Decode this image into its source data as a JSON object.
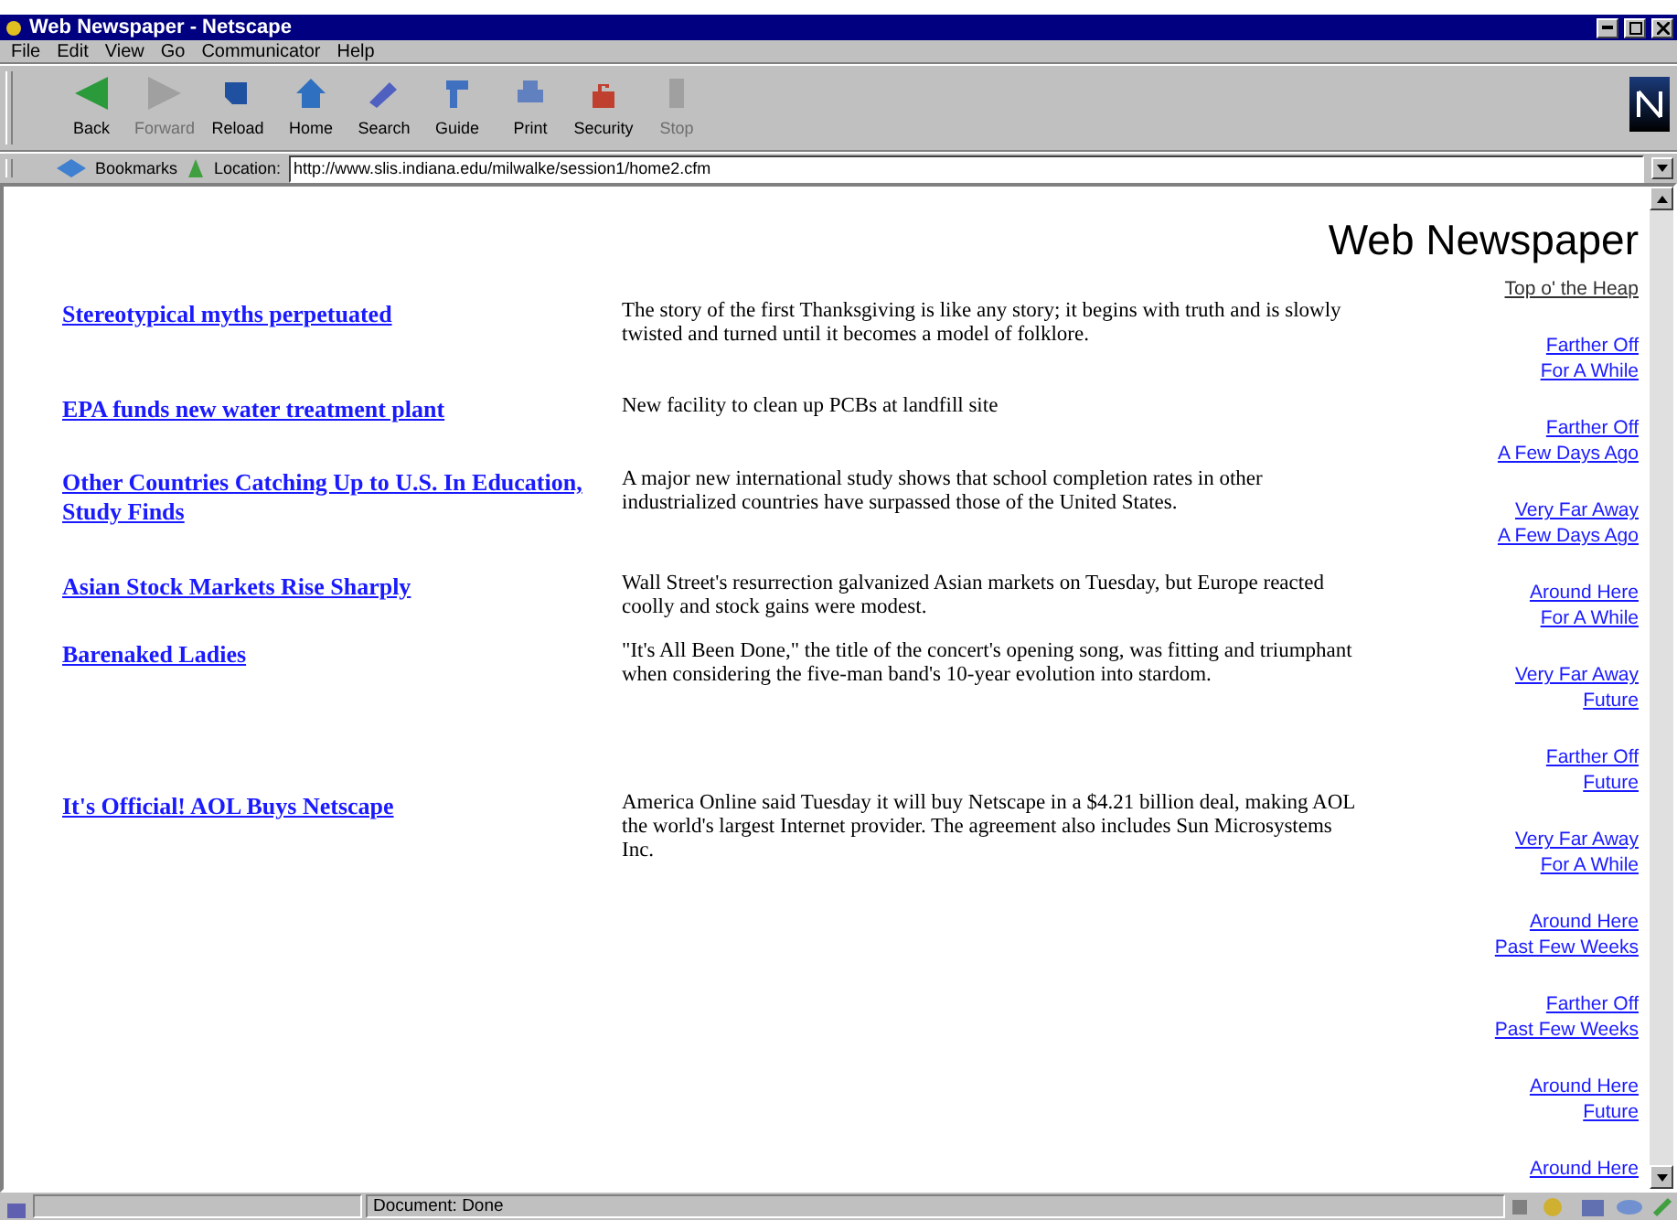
{
  "window": {
    "title": "Web Newspaper - Netscape"
  },
  "menu": [
    "File",
    "Edit",
    "View",
    "Go",
    "Communicator",
    "Help"
  ],
  "toolbar": [
    {
      "label": "Back",
      "kind": "back",
      "disabled": false
    },
    {
      "label": "Forward",
      "kind": "forward",
      "disabled": true
    },
    {
      "label": "Reload",
      "kind": "reload",
      "disabled": false
    },
    {
      "label": "Home",
      "kind": "home",
      "disabled": false
    },
    {
      "label": "Search",
      "kind": "search",
      "disabled": false
    },
    {
      "label": "Guide",
      "kind": "guide",
      "disabled": false
    },
    {
      "label": "Print",
      "kind": "print",
      "disabled": false
    },
    {
      "label": "Security",
      "kind": "security",
      "disabled": false
    },
    {
      "label": "Stop",
      "kind": "stop",
      "disabled": true
    }
  ],
  "location_bar": {
    "bookmarks": "Bookmarks",
    "label": "Location:",
    "url": "http://www.slis.indiana.edu/milwalke/session1/home2.cfm"
  },
  "page": {
    "heading": "Web Newspaper",
    "articles": [
      {
        "headline": "Stereotypical myths perpetuated",
        "summary": "The story of the first Thanksgiving is like any story; it begins with truth and is slowly twisted and turned until it becomes a model of folklore."
      },
      {
        "headline": "EPA funds new water treatment plant",
        "summary": "New facility to clean up PCBs at landfill site"
      },
      {
        "headline": "Other Countries Catching Up to U.S. In Education, Study Finds",
        "summary": "A major new international study shows that school completion rates in other industrialized countries have surpassed those of the United States."
      },
      {
        "headline": "Asian Stock Markets Rise Sharply",
        "summary": "Wall Street's resurrection galvanized Asian markets on Tuesday, but Europe reacted coolly and stock gains were modest."
      },
      {
        "headline": "Barenaked Ladies",
        "summary": "\"It's All Been Done,\" the title of the concert's opening song, was fitting and triumphant when considering the five-man band's 10-year evolution into stardom."
      },
      {
        "headline": "It's Official! AOL Buys Netscape",
        "summary": "America Online said Tuesday it will buy Netscape in a $4.21 billion deal, making AOL the world's largest Internet provider. The agreement also includes Sun Microsystems Inc."
      }
    ],
    "nav_links": [
      {
        "lines": [
          "Top o' the Heap"
        ],
        "visited": true
      },
      {
        "lines": [
          "Farther Off",
          "For A While"
        ],
        "visited": false
      },
      {
        "lines": [
          "Farther Off",
          "A Few Days Ago"
        ],
        "visited": false
      },
      {
        "lines": [
          "Very Far Away",
          "A Few Days Ago"
        ],
        "visited": false
      },
      {
        "lines": [
          "Around Here",
          "For A While"
        ],
        "visited": false
      },
      {
        "lines": [
          "Very Far Away",
          "Future"
        ],
        "visited": false
      },
      {
        "lines": [
          "Farther Off",
          "Future"
        ],
        "visited": false
      },
      {
        "lines": [
          "Very Far Away",
          "For A While"
        ],
        "visited": false
      },
      {
        "lines": [
          "Around Here",
          "Past Few Weeks"
        ],
        "visited": false
      },
      {
        "lines": [
          "Farther Off",
          "Past Few Weeks"
        ],
        "visited": false
      },
      {
        "lines": [
          "Around Here",
          "Future"
        ],
        "visited": false
      },
      {
        "lines": [
          "Around Here"
        ],
        "visited": false
      }
    ]
  },
  "status_bar": {
    "text": "Document: Done"
  }
}
